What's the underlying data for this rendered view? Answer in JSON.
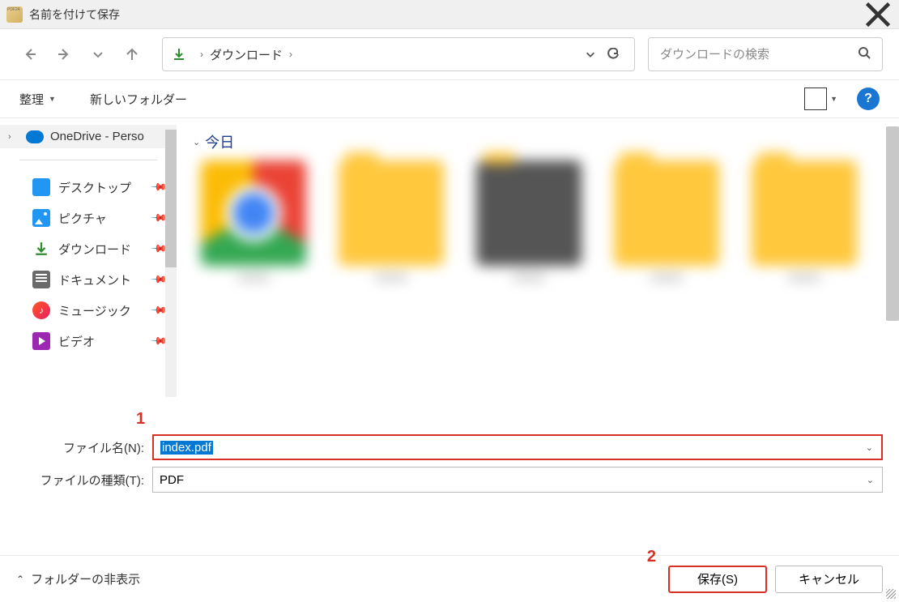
{
  "window": {
    "title": "名前を付けて保存"
  },
  "address": {
    "crumb": "ダウンロード"
  },
  "search": {
    "placeholder": "ダウンロードの検索"
  },
  "toolbar": {
    "organize": "整理",
    "new_folder": "新しいフォルダー"
  },
  "sidebar": {
    "onedrive": "OneDrive - Perso",
    "items": [
      {
        "label": "デスクトップ"
      },
      {
        "label": "ピクチャ"
      },
      {
        "label": "ダウンロード"
      },
      {
        "label": "ドキュメント"
      },
      {
        "label": "ミュージック"
      },
      {
        "label": "ビデオ"
      }
    ]
  },
  "content": {
    "group": "今日"
  },
  "form": {
    "filename_label": "ファイル名(N):",
    "filename_value": "index.pdf",
    "filetype_label": "ファイルの種類(T):",
    "filetype_value": "PDF"
  },
  "footer": {
    "hide_folders": "フォルダーの非表示",
    "save": "保存(S)",
    "cancel": "キャンセル"
  },
  "annotations": {
    "one": "1",
    "two": "2"
  }
}
